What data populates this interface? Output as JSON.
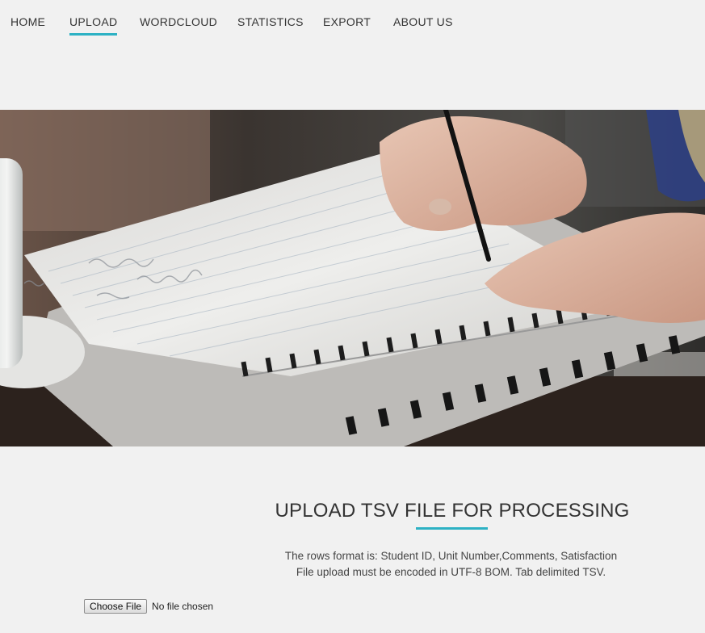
{
  "nav": {
    "items": [
      {
        "label": "HOME",
        "active": false
      },
      {
        "label": "UPLOAD",
        "active": true
      },
      {
        "label": "WORDCLOUD",
        "active": false
      },
      {
        "label": "STATISTICS",
        "active": false
      },
      {
        "label": "EXPORT",
        "active": false
      },
      {
        "label": "ABOUT US",
        "active": false
      }
    ],
    "accent_color": "#2db1c4"
  },
  "hero": {
    "image_subject": "hands-writing-in-spiral-notebook-photo"
  },
  "upload": {
    "title": "UPLOAD TSV FILE FOR PROCESSING",
    "line1": "The rows format is: Student ID, Unit Number,Comments, Satisfaction",
    "line2": "File upload must be encoded in UTF-8 BOM. Tab delimited TSV.",
    "choose_file_label": "Choose File",
    "file_status": "No file chosen"
  }
}
